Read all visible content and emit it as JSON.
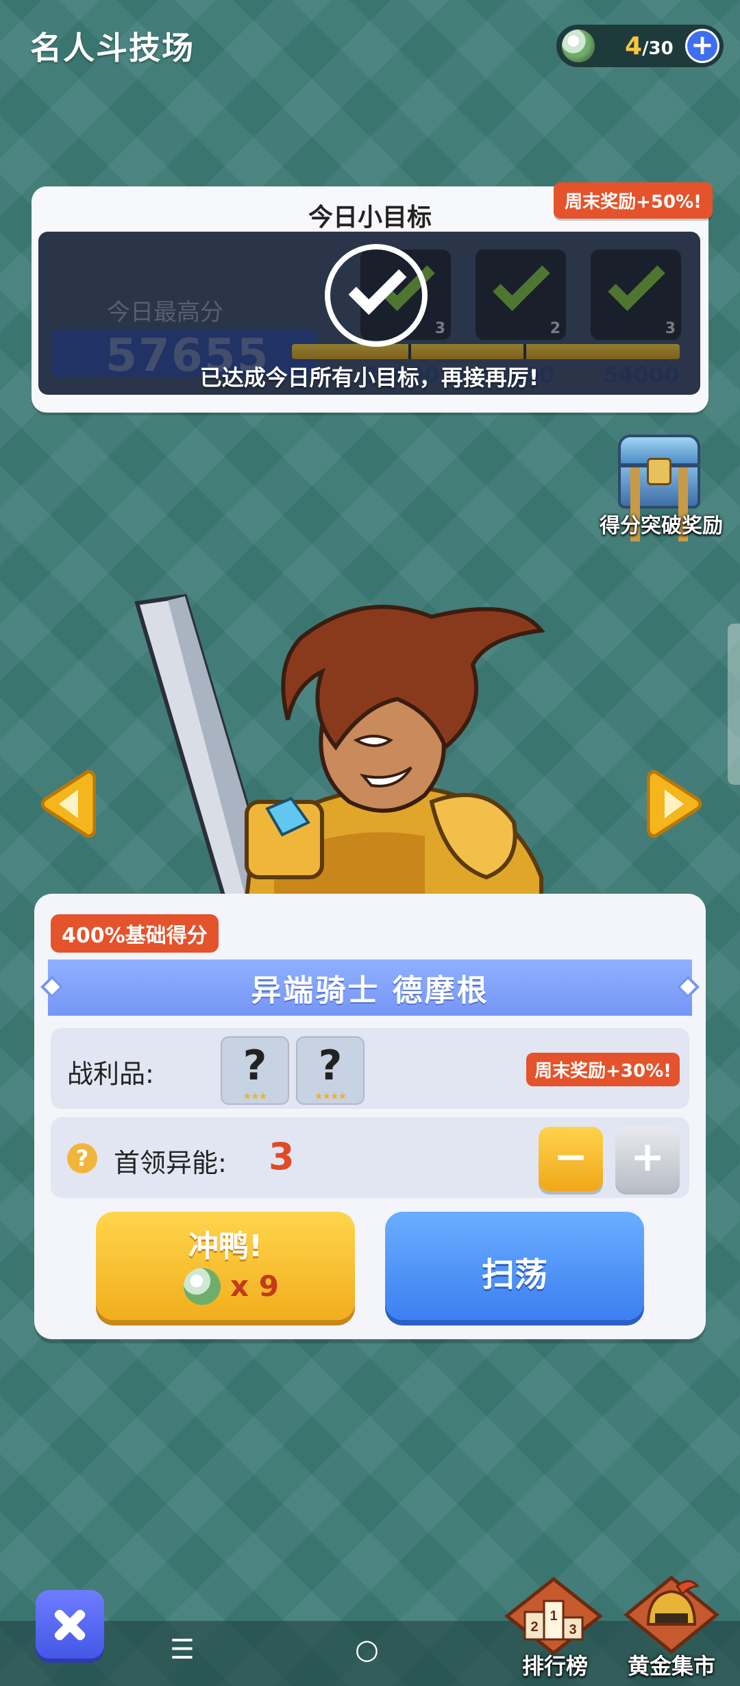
{
  "header": {
    "title": "名人斗技场",
    "energy_current": "4",
    "energy_max": "/30",
    "energy_icon": "energy-ball-icon",
    "add_icon": "plus-icon"
  },
  "daily_goal": {
    "title": "今日小目标",
    "weekend_bonus": "周末奖励+50%!",
    "high_score_label": "今日最高分",
    "high_score_value": "57655",
    "goal_counts": [
      "3",
      "2",
      "3"
    ],
    "score_marks": [
      "36000",
      "45000",
      "54000"
    ],
    "completed_text": "已达成今日所有小目标，再接再厉!"
  },
  "score_reward": {
    "label": "得分突破奖励",
    "icon": "treasure-chest-icon"
  },
  "hero": {
    "base_score_badge": "400%基础得分",
    "name": "异端骑士  德摩根",
    "loot_label": "战利品:",
    "loot_items": [
      {
        "symbol": "?",
        "stars": "★★★"
      },
      {
        "symbol": "?",
        "stars": "★★★★"
      }
    ],
    "loot_weekend_bonus": "周末奖励+30%!",
    "boss_label": "首领异能:",
    "boss_value": "3",
    "minus_icon": "minus-icon",
    "plus_icon": "plus-icon"
  },
  "actions": {
    "go_label": "冲鸭!",
    "go_cost": "x 9",
    "sweep_label": "扫荡"
  },
  "bottom": {
    "rank_label": "排行榜",
    "market_label": "黄金集市",
    "nav_menu": "☰",
    "nav_home": "○",
    "close_icon": "close-icon"
  },
  "colors": {
    "background": "#3f7d78",
    "accent_red": "#e4532b",
    "accent_blue": "#3d7ff1",
    "accent_yellow": "#f1ae1c",
    "progress_fill": "#f5d23a"
  }
}
